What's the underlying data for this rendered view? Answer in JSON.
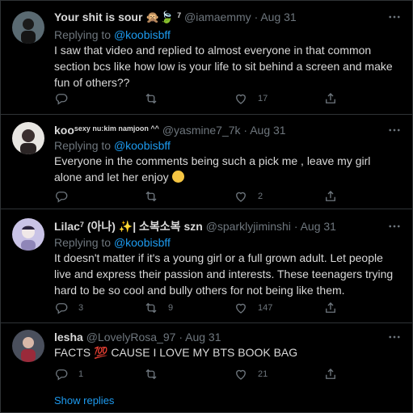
{
  "tweets": [
    {
      "display_name": "Your shit is sour",
      "name_suffix": "7",
      "handle": "@iamaemmy",
      "date": "· Aug 31",
      "replying_prefix": "Replying to",
      "replying_to": "@koobisbff",
      "text": "I saw that video and replied to almost everyone in that common section bcs like how low is your life to sit behind a screen and make fun of others??",
      "replies": "",
      "retweets": "",
      "likes": "17",
      "avatar_color": "#5a6a72"
    },
    {
      "display_name": "koo",
      "name_suffix": "sexy nu:kim namjoon ^^",
      "handle": "@yasmine7_7k",
      "date": "· Aug 31",
      "replying_prefix": "Replying to",
      "replying_to": "@koobisbff",
      "text": "Everyone in the comments being such a pick me , leave my girl alone and let her enjoy",
      "replies": "",
      "retweets": "",
      "likes": "2",
      "avatar_color": "#e8e6e2"
    },
    {
      "display_name": "Lilac",
      "name_suffix": "7",
      "name_extra": "(아나)",
      "name_korean": "| 소복소복 szn",
      "handle": "@sparklyjiminshi",
      "date": "· Aug 31",
      "replying_prefix": "Replying to",
      "replying_to": "@koobisbff",
      "text": "It doesn't matter if it's a young girl or a full grown adult. Let people live and express their passion and interests. These teenagers trying hard to be so cool and bully others for not being like them.",
      "replies": "3",
      "retweets": "9",
      "likes": "147",
      "avatar_color": "#c9c3e6"
    },
    {
      "display_name": "lesha",
      "handle": "@LovelyRosa_97",
      "date": "· Aug 31",
      "text": "FACTS 💯 CAUSE I LOVE MY BTS BOOK BAG",
      "replies": "1",
      "retweets": "",
      "likes": "21",
      "avatar_color": "#4a4f5c"
    }
  ],
  "show_replies": "Show replies",
  "colors": {
    "accent": "#1d9bf0",
    "muted": "#6e767d",
    "text": "#d9d9d9",
    "border": "#2f3336",
    "background": "#000000"
  }
}
